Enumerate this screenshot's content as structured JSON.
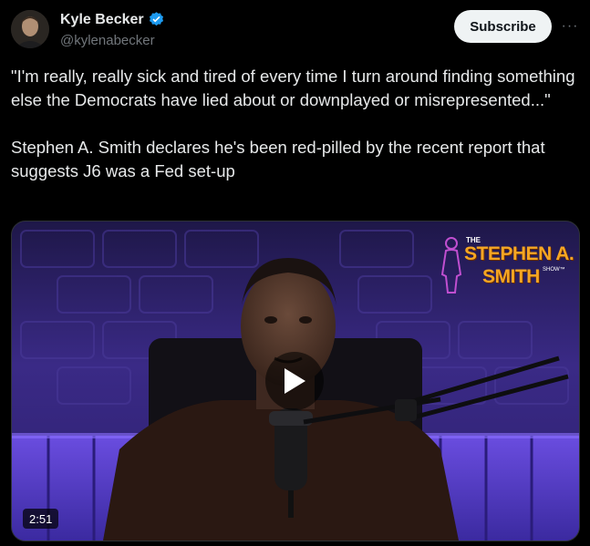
{
  "author": {
    "name": "Kyle Becker",
    "handle": "@kylenabecker",
    "verified_icon": "verified-badge-icon"
  },
  "actions": {
    "subscribe_label": "Subscribe",
    "more_label": "···"
  },
  "tweet": {
    "text": "\"I'm really, really sick and tired of every time I turn around finding something else the Democrats have lied about or downplayed or misrepresented...\"\n\nStephen A. Smith declares he's been red-pilled by the recent report that suggests J6 was a Fed set-up"
  },
  "media": {
    "duration": "2:51",
    "logo_the": "THE",
    "logo_line1": "STEPHEN A.",
    "logo_line2": "SMITH",
    "logo_show": "SHOW™",
    "play_icon": "play-icon"
  },
  "colors": {
    "background": "#000000",
    "text": "#e7e9ea",
    "secondary": "#71767b",
    "verified": "#1d9bf0",
    "logo": "#f5a623"
  }
}
